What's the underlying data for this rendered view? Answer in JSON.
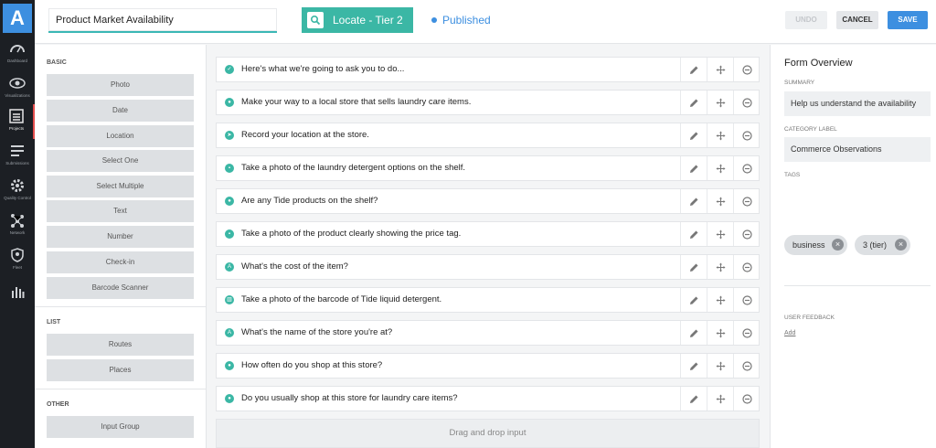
{
  "app": {
    "logo_letter": "A"
  },
  "nav": {
    "items": [
      {
        "label": "Dashboard",
        "icon": "gauge-icon"
      },
      {
        "label": "Visualizations",
        "icon": "eye-icon"
      },
      {
        "label": "Projects",
        "icon": "projects-icon",
        "active": true
      },
      {
        "label": "Submissions",
        "icon": "list-icon"
      },
      {
        "label": "Quality Control",
        "icon": "gear-icon"
      },
      {
        "label": "Network",
        "icon": "network-icon"
      },
      {
        "label": "Fleet",
        "icon": "shield-icon"
      },
      {
        "label": "",
        "icon": "bar-chart-icon"
      }
    ]
  },
  "header": {
    "title_value": "Product Market Availability",
    "locate_label": "Locate - Tier 2",
    "status": "Published",
    "undo_label": "UNDO",
    "cancel_label": "CANCEL",
    "save_label": "SAVE"
  },
  "palette": {
    "basic_title": "BASIC",
    "basic": [
      "Photo",
      "Date",
      "Location",
      "Select One",
      "Select Multiple",
      "Text",
      "Number",
      "Check-in",
      "Barcode Scanner"
    ],
    "list_title": "LIST",
    "list": [
      "Routes",
      "Places"
    ],
    "other_title": "OTHER",
    "other": [
      "Input Group"
    ]
  },
  "questions": [
    {
      "text": "Here's what we're going to ask you to do...",
      "icon": "check"
    },
    {
      "text": "Make your way to a local store that sells laundry care items.",
      "icon": "check-in"
    },
    {
      "text": "Record your location at the store.",
      "icon": "location"
    },
    {
      "text": "Take a photo of the laundry detergent options on the shelf.",
      "icon": "photo"
    },
    {
      "text": "Are any Tide products on the shelf?",
      "icon": "select-one"
    },
    {
      "text": "Take a photo of the product clearly showing the price tag.",
      "icon": "photo"
    },
    {
      "text": "What's the cost of the item?",
      "icon": "text"
    },
    {
      "text": "Take a photo of the barcode of Tide liquid detergent.",
      "icon": "barcode"
    },
    {
      "text": "What's the name of the store you're at?",
      "icon": "text"
    },
    {
      "text": "How often do you shop at this store?",
      "icon": "select-one"
    },
    {
      "text": "Do you usually shop at this store for laundry care items?",
      "icon": "select-one"
    }
  ],
  "dropzone_label": "Drag and drop input",
  "overview": {
    "title": "Form Overview",
    "summary_label": "SUMMARY",
    "summary_value": "Help us understand the availability",
    "category_label": "CATEGORY LABEL",
    "category_value": "Commerce Observations",
    "tags_label": "TAGS",
    "tags": [
      "business",
      "3 (tier)"
    ],
    "feedback_label": "USER FEEDBACK",
    "add_label": "Add"
  },
  "colors": {
    "accent": "#3bb7a5",
    "primary": "#3d8fe0",
    "nav_bg": "#1c1f24"
  }
}
